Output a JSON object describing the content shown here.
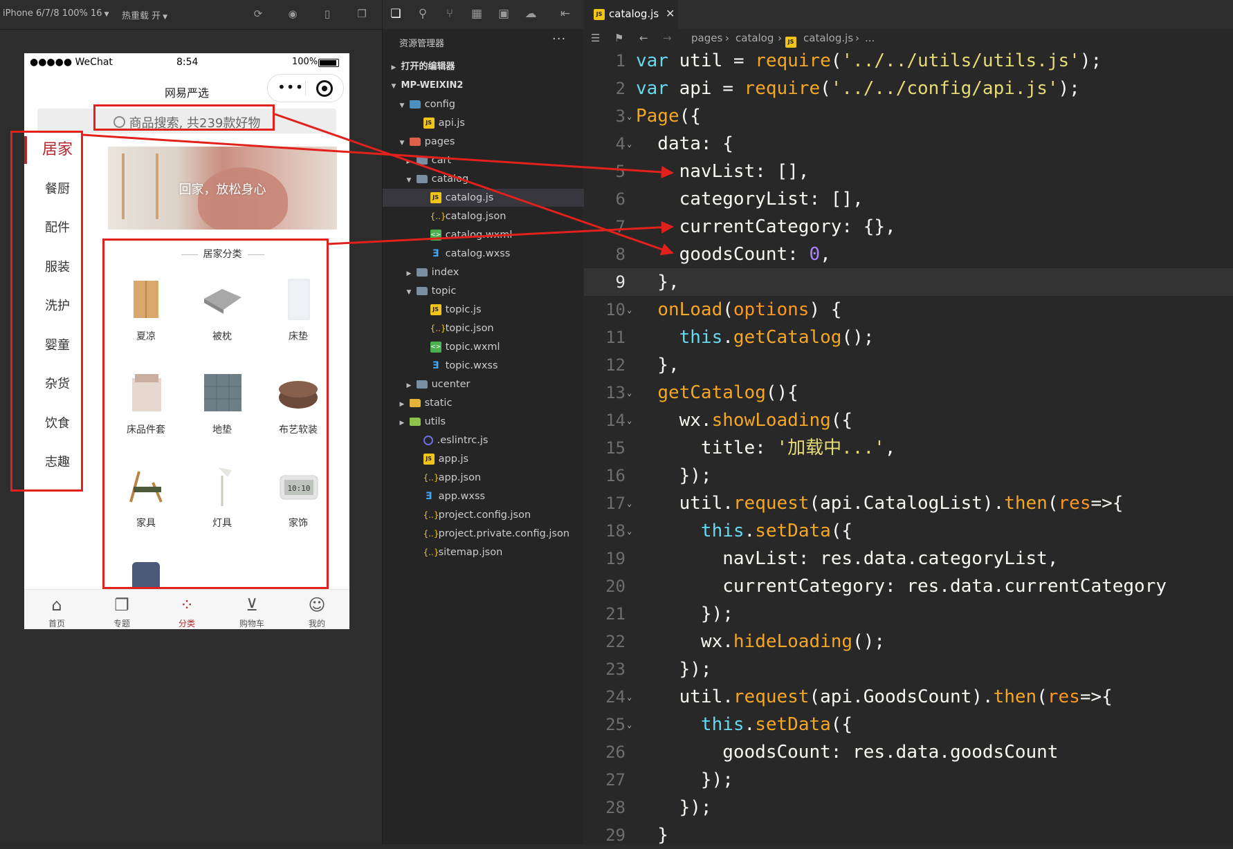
{
  "simulator": {
    "toolbar": {
      "device": "iPhone 6/7/8 100% 16",
      "hot_reload": "热重载 开"
    },
    "status": {
      "carrier": "●●●●● WeChat",
      "time": "8:54",
      "battery": "100%"
    },
    "nav_title": "网易严选",
    "search_placeholder": "商品搜索, 共239款好物",
    "nav_items": [
      "居家",
      "餐厨",
      "配件",
      "服装",
      "洗护",
      "婴童",
      "杂货",
      "饮食",
      "志趣"
    ],
    "banner_text": "回家，放松身心",
    "category_title": "居家分类",
    "grid_items": [
      "夏凉",
      "被枕",
      "床垫",
      "床品件套",
      "地垫",
      "布艺软装",
      "家具",
      "灯具",
      "家饰"
    ],
    "tabs": [
      "首页",
      "专题",
      "分类",
      "购物车",
      "我的"
    ],
    "colors": {
      "accent": "#b4282d",
      "annotation": "#e3211c"
    }
  },
  "explorer": {
    "header": "资源管理器",
    "more": "···",
    "open_editors": "打开的编辑器",
    "root": "MP-WEIXIN2",
    "tree": [
      "config",
      "api.js",
      "pages",
      "cart",
      "catalog",
      "catalog.js",
      "catalog.json",
      "catalog.wxml",
      "catalog.wxss",
      "index",
      "topic",
      "topic.js",
      "topic.json",
      "topic.wxml",
      "topic.wxss",
      "ucenter",
      "static",
      "utils",
      ".eslintrc.js",
      "app.js",
      "app.json",
      "app.wxss",
      "project.config.json",
      "project.private.config.json",
      "sitemap.json"
    ]
  },
  "editor": {
    "tab_label": "catalog.js",
    "breadcrumb": [
      "pages",
      "catalog",
      "catalog.js",
      "..."
    ],
    "current_line": 9
  }
}
